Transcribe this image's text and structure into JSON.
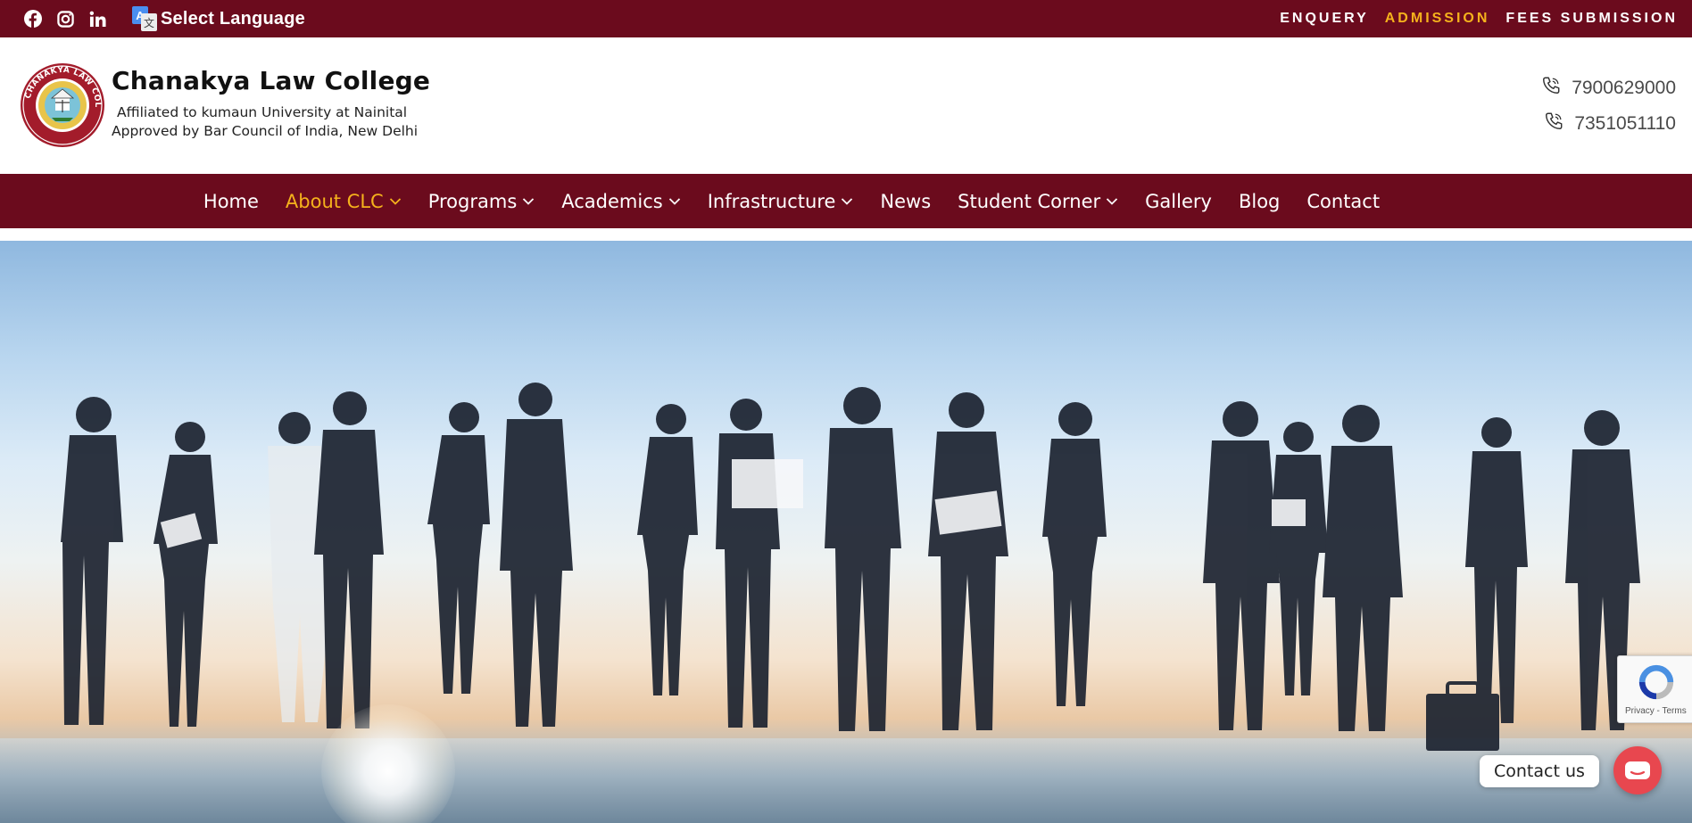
{
  "topbar": {
    "social_icons": [
      "facebook-icon",
      "instagram-icon",
      "linkedin-icon"
    ],
    "language_label": "Select Language",
    "links": [
      {
        "label": "ENQUERY",
        "active": false
      },
      {
        "label": "ADMISSION",
        "active": true
      },
      {
        "label": "FEES SUBMISSION",
        "active": false
      }
    ]
  },
  "header": {
    "brand_name": "Chanakya Law College",
    "line1": "Affiliated to kumaun University at Nainital",
    "line2": "Approved by Bar Council of India, New Delhi",
    "logo_text": "CHANAKYA LAW COLLEGE · RUDRAPUR (U.S. NAGAR)",
    "phones": [
      "7900629000",
      "7351051110"
    ]
  },
  "nav": {
    "items": [
      {
        "label": "Home",
        "dropdown": false,
        "active": false
      },
      {
        "label": "About CLC",
        "dropdown": true,
        "active": true
      },
      {
        "label": "Programs",
        "dropdown": true,
        "active": false
      },
      {
        "label": "Academics",
        "dropdown": true,
        "active": false
      },
      {
        "label": "Infrastructure",
        "dropdown": true,
        "active": false
      },
      {
        "label": "News",
        "dropdown": false,
        "active": false
      },
      {
        "label": "Student Corner",
        "dropdown": true,
        "active": false
      },
      {
        "label": "Gallery",
        "dropdown": false,
        "active": false
      },
      {
        "label": "Blog",
        "dropdown": false,
        "active": false
      },
      {
        "label": "Contact",
        "dropdown": false,
        "active": false
      }
    ]
  },
  "recaptcha": {
    "text": "Privacy - Terms"
  },
  "chat": {
    "label": "Contact us"
  },
  "colors": {
    "primary": "#6b0b1d",
    "accent": "#f5b21c",
    "chat": "#e8474f"
  }
}
